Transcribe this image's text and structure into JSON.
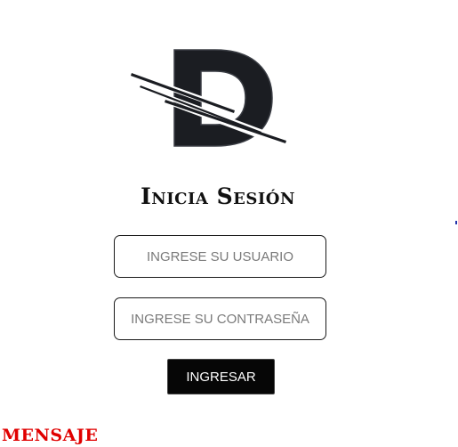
{
  "logo": {
    "icon": "d-letter-logo-icon",
    "color": "#1b1d22"
  },
  "header": {
    "title": "Inicia Sesión"
  },
  "form": {
    "username_placeholder": "INGRESE SU USUARIO",
    "username_value": "",
    "password_placeholder": "INGRESE SU CONTRASEÑA",
    "password_value": "",
    "submit_label": "INGRESAR"
  },
  "message": {
    "text": "MENSAJE",
    "color": "#e00000"
  }
}
